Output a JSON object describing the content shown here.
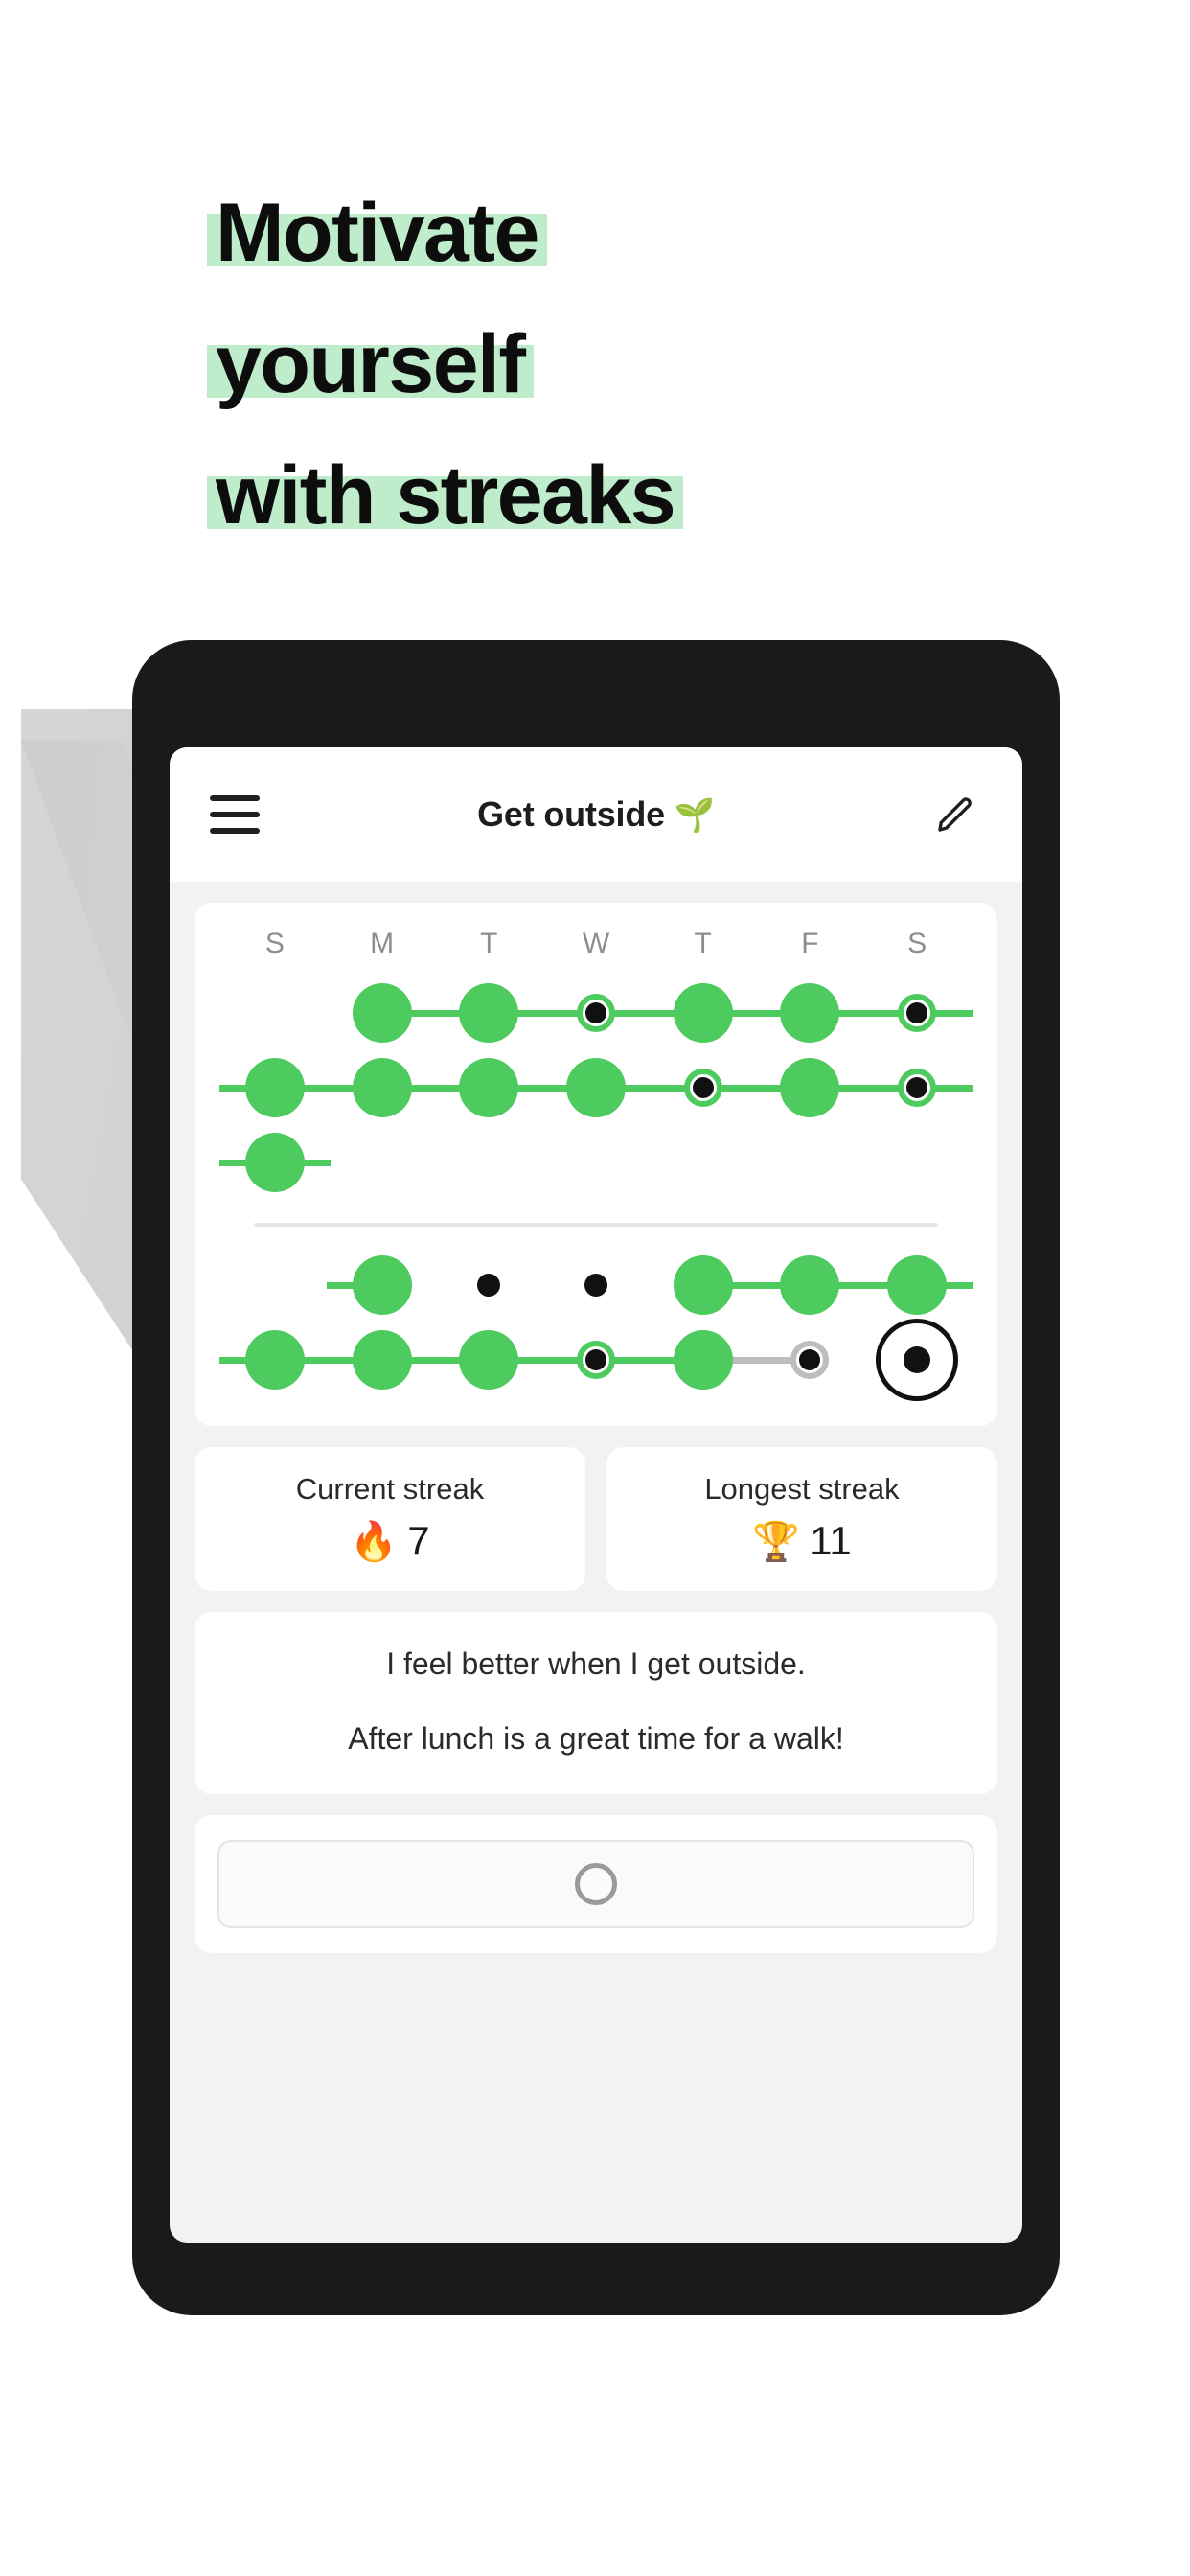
{
  "headline": {
    "lines": [
      "Motivate",
      "yourself",
      "with streaks"
    ],
    "highlight_color": "#bfeccb"
  },
  "app": {
    "appbar": {
      "menu_icon": "hamburger-menu-icon",
      "title": "Get outside",
      "title_emoji": "🌱",
      "edit_icon": "pencil-edit-icon"
    },
    "habit_grid": {
      "weekday_labels": [
        "S",
        "M",
        "T",
        "W",
        "T",
        "F",
        "S"
      ],
      "accent_color": "#4ECB5E",
      "rows_top": [
        {
          "cells": [
            {
              "type": "empty"
            },
            {
              "type": "full",
              "line_right": "green"
            },
            {
              "type": "full",
              "line_left": "green",
              "line_right": "green"
            },
            {
              "type": "ring",
              "line_left": "green",
              "line_right": "green"
            },
            {
              "type": "full",
              "line_left": "green",
              "line_right": "green"
            },
            {
              "type": "full",
              "line_left": "green",
              "line_right": "green"
            },
            {
              "type": "ring",
              "line_left": "green",
              "line_right": "green"
            }
          ]
        },
        {
          "cells": [
            {
              "type": "full",
              "line_left": "green",
              "line_right": "green"
            },
            {
              "type": "full",
              "line_left": "green",
              "line_right": "green"
            },
            {
              "type": "full",
              "line_left": "green",
              "line_right": "green"
            },
            {
              "type": "full",
              "line_left": "green",
              "line_right": "green"
            },
            {
              "type": "ring",
              "line_left": "green",
              "line_right": "green"
            },
            {
              "type": "full",
              "line_left": "green",
              "line_right": "green"
            },
            {
              "type": "ring",
              "line_left": "green",
              "line_right": "green"
            }
          ]
        },
        {
          "cells": [
            {
              "type": "full",
              "line_left": "green",
              "line_right": "green"
            },
            {
              "type": "empty"
            },
            {
              "type": "empty"
            },
            {
              "type": "empty"
            },
            {
              "type": "empty"
            },
            {
              "type": "empty"
            },
            {
              "type": "empty"
            }
          ]
        }
      ],
      "rows_bottom": [
        {
          "cells": [
            {
              "type": "empty"
            },
            {
              "type": "full",
              "line_left": "green"
            },
            {
              "type": "small"
            },
            {
              "type": "small"
            },
            {
              "type": "full",
              "line_right": "green"
            },
            {
              "type": "full",
              "line_left": "green",
              "line_right": "green"
            },
            {
              "type": "full",
              "line_left": "green",
              "line_right": "green"
            }
          ]
        },
        {
          "cells": [
            {
              "type": "full",
              "line_left": "green",
              "line_right": "green"
            },
            {
              "type": "full",
              "line_left": "green",
              "line_right": "green"
            },
            {
              "type": "full",
              "line_left": "green",
              "line_right": "green"
            },
            {
              "type": "ring",
              "line_left": "green",
              "line_right": "green"
            },
            {
              "type": "full",
              "line_left": "green",
              "line_right": "gray"
            },
            {
              "type": "ring-gray",
              "line_left": "gray"
            },
            {
              "type": "today"
            }
          ]
        }
      ]
    },
    "streaks": [
      {
        "label": "Current streak",
        "emoji": "🔥",
        "value": "7",
        "name": "current-streak"
      },
      {
        "label": "Longest streak",
        "emoji": "🏆",
        "value": "11",
        "name": "longest-streak"
      }
    ],
    "notes": [
      "I feel better when I get outside.",
      "After lunch is a great time for a walk!"
    ],
    "checkin": {
      "icon": "empty-circle-icon",
      "label": ""
    }
  }
}
